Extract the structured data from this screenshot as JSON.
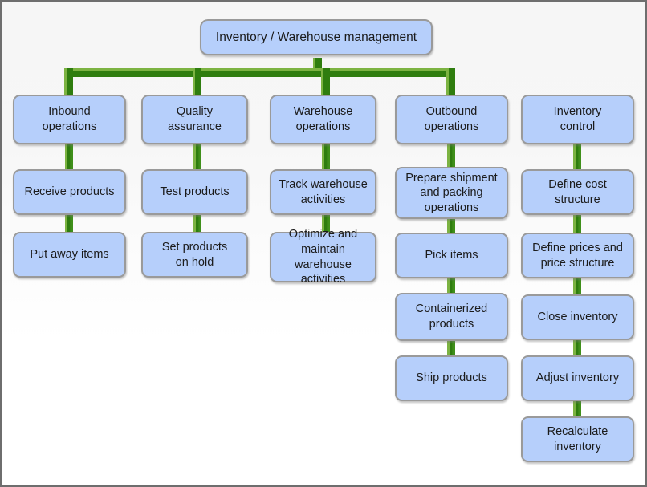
{
  "diagram": {
    "title": "Inventory / Warehouse management",
    "type": "org-chart",
    "root": {
      "id": "root",
      "label": "Inventory / Warehouse management"
    },
    "columns": [
      {
        "id": "inbound",
        "header": "Inbound\noperations",
        "items": [
          "Receive products",
          "Put away items"
        ]
      },
      {
        "id": "quality",
        "header": "Quality\nassurance",
        "items": [
          "Test products",
          "Set products\non hold"
        ]
      },
      {
        "id": "warehouse",
        "header": "Warehouse\noperations",
        "items": [
          "Track warehouse\nactivities",
          "Optimize and\nmaintain warehouse\nactivities"
        ]
      },
      {
        "id": "outbound",
        "header": "Outbound\noperations",
        "items": [
          "Prepare shipment\nand packing\noperations",
          "Pick items",
          "Containerized\nproducts",
          "Ship products"
        ]
      },
      {
        "id": "inventory-control",
        "header": "Inventory\ncontrol",
        "items": [
          "Define cost\nstructure",
          "Define prices and\nprice structure",
          "Close inventory",
          "Adjust inventory",
          "Recalculate\ninventory"
        ]
      }
    ],
    "colors": {
      "node_fill": "#b6cffb",
      "node_border": "#9a9a9a",
      "connector_dark": "#2f7d0f",
      "connector_light": "#7cb342",
      "canvas_border": "#6e6e6e",
      "text": "#1b1b1b"
    }
  }
}
